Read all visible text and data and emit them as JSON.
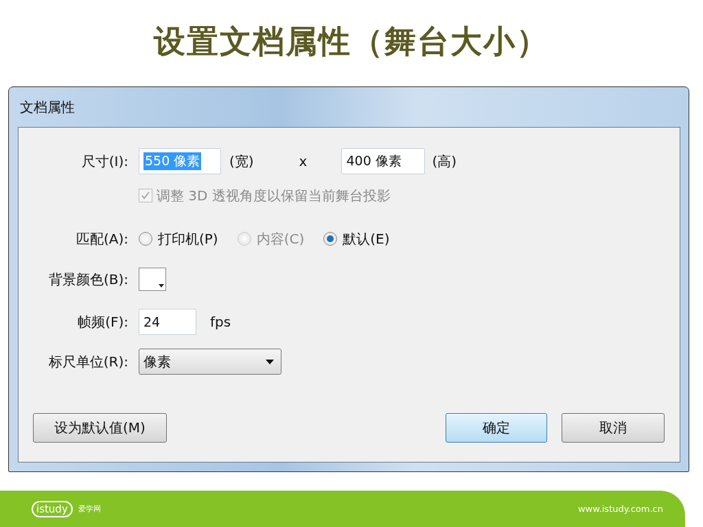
{
  "slide_title": "设置文档属性（舞台大小）",
  "dialog": {
    "title": "文档属性",
    "size": {
      "label": "尺寸(I):",
      "width_value": "550 像素",
      "width_selected": true,
      "width_unit": "(宽)",
      "separator": "x",
      "height_value": "400 像素",
      "height_unit": "(高)"
    },
    "perspective_checkbox": {
      "label": "调整 3D 透视角度以保留当前舞台投影",
      "checked": true,
      "disabled": true
    },
    "match": {
      "label": "匹配(A):",
      "options": [
        {
          "label": "打印机(P)",
          "selected": false,
          "disabled": false
        },
        {
          "label": "内容(C)",
          "selected": false,
          "disabled": true
        },
        {
          "label": "默认(E)",
          "selected": true,
          "disabled": false
        }
      ]
    },
    "background_color": {
      "label": "背景颜色(B):"
    },
    "frame_rate": {
      "label": "帧频(F):",
      "value": "24",
      "unit": "fps"
    },
    "ruler_units": {
      "label": "标尺单位(R):",
      "value": "像素"
    },
    "buttons": [
      {
        "label": "设为默认值(M)",
        "kind": "secondary"
      },
      {
        "label": "确定",
        "kind": "default"
      },
      {
        "label": "取消",
        "kind": "secondary"
      }
    ]
  },
  "footer": {
    "logo": "istudy",
    "site_name": "爱学网",
    "url": "www.istudy.com.cn"
  }
}
